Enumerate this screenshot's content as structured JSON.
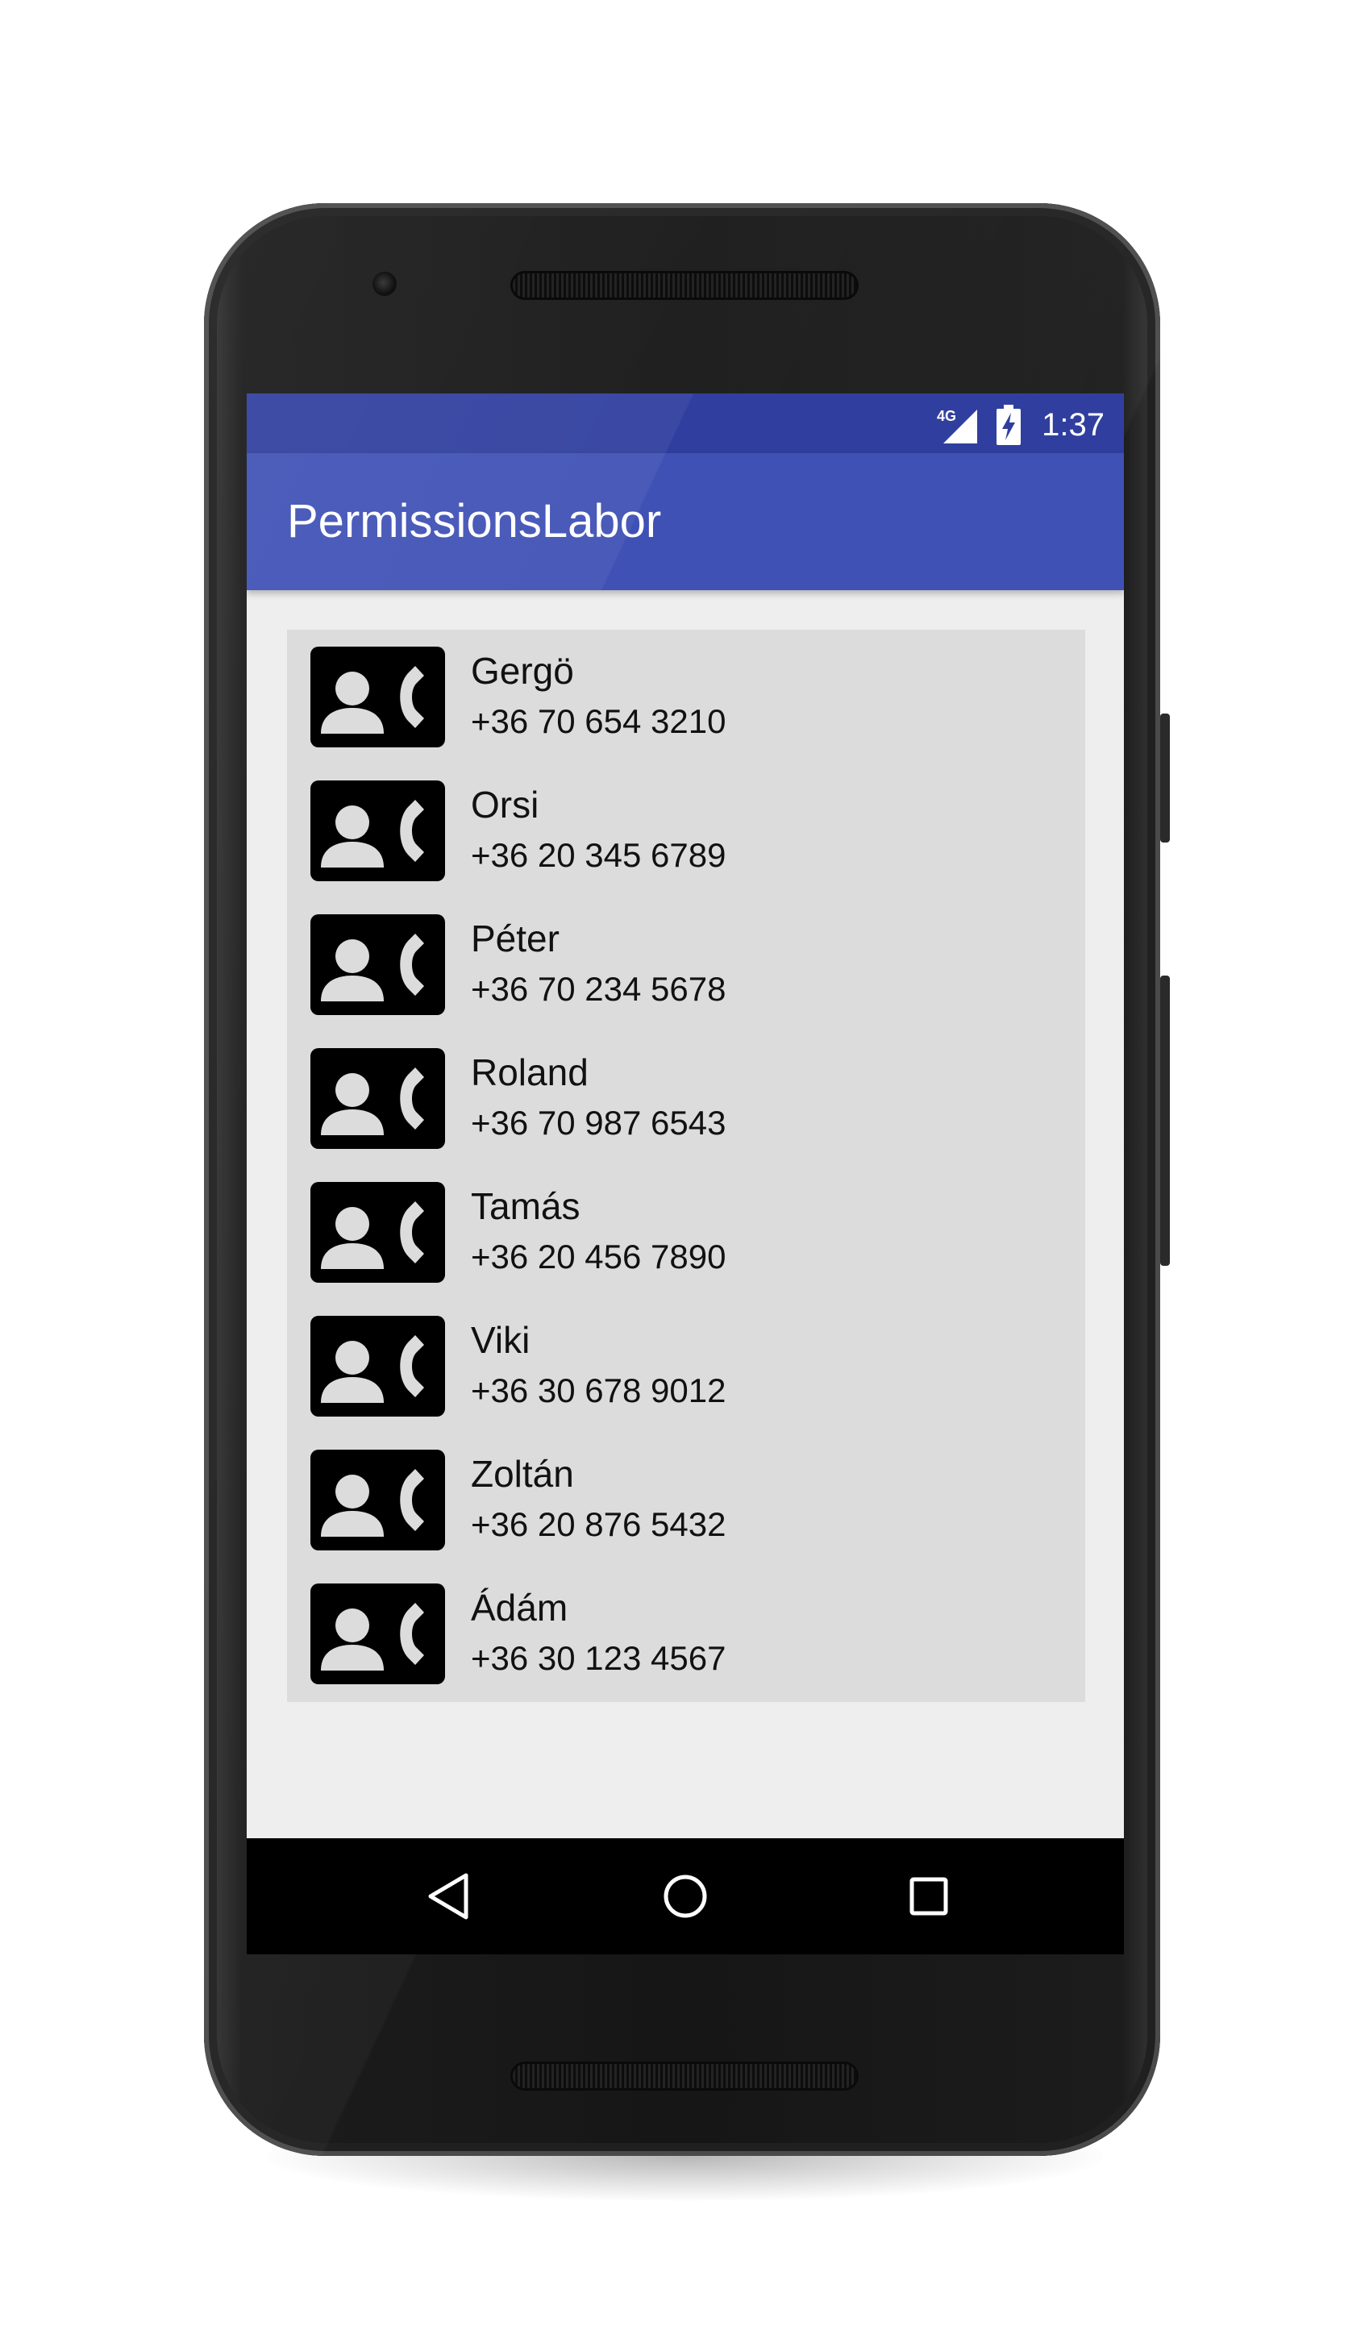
{
  "status_bar": {
    "network": "4G",
    "time": "1:37"
  },
  "app_bar": {
    "title": "PermissionsLabor"
  },
  "contacts": [
    {
      "name": "Gergö",
      "phone": "+36 70 654 3210"
    },
    {
      "name": "Orsi",
      "phone": "+36 20 345 6789"
    },
    {
      "name": "Péter",
      "phone": "+36 70 234 5678"
    },
    {
      "name": "Roland",
      "phone": "+36 70 987 6543"
    },
    {
      "name": "Tamás",
      "phone": "+36 20 456 7890"
    },
    {
      "name": "Viki",
      "phone": "+36 30 678 9012"
    },
    {
      "name": "Zoltán",
      "phone": "+36 20 876 5432"
    },
    {
      "name": "Ádám",
      "phone": "+36 30 123 4567"
    }
  ],
  "icons": {
    "contact": "contact-phone-icon",
    "back": "back-triangle-icon",
    "home": "home-circle-icon",
    "recents": "recents-square-icon",
    "signal": "cell-signal-icon",
    "battery": "battery-charging-icon"
  },
  "colors": {
    "primary": "#3f51b5",
    "primary_dark": "#303f9f",
    "list_background": "#dcdcdc",
    "screen_background": "#eeeeee"
  }
}
